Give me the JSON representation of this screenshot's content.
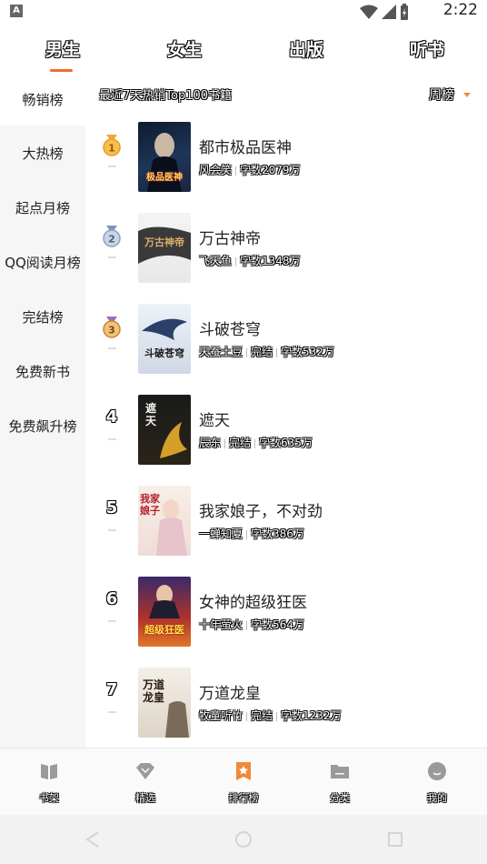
{
  "status": {
    "time": "2:22",
    "badge": "A"
  },
  "top_tabs": [
    "男生",
    "女生",
    "出版",
    "听书"
  ],
  "sidebar": {
    "items": [
      "畅销榜",
      "大热榜",
      "起点月榜",
      "QQ阅读月榜",
      "完结榜",
      "免费新书",
      "免费飙升榜"
    ]
  },
  "list_header": {
    "title": "最近7天热销Top100书籍",
    "period": "周榜"
  },
  "books": [
    {
      "rank": "1",
      "title": "都市极品医神",
      "author": "风会笑",
      "status": "",
      "words": "字数2079万",
      "cover_text": "极品医神"
    },
    {
      "rank": "2",
      "title": "万古神帝",
      "author": "飞天鱼",
      "status": "",
      "words": "字数1348万",
      "cover_text": "万古神帝"
    },
    {
      "rank": "3",
      "title": "斗破苍穹",
      "author": "天蚕土豆",
      "status": "完结",
      "words": "字数532万",
      "cover_text": "斗破苍穹"
    },
    {
      "rank": "4",
      "title": "遮天",
      "author": "辰东",
      "status": "完结",
      "words": "字数635万",
      "cover_text": "遮天"
    },
    {
      "rank": "5",
      "title": "我家娘子，不对劲",
      "author": "一蝉知夏",
      "status": "",
      "words": "字数386万",
      "cover_text": "我家娘子"
    },
    {
      "rank": "6",
      "title": "女神的超级狂医",
      "author": "十年萤火",
      "status": "",
      "words": "字数564万",
      "cover_text": "超级狂医"
    },
    {
      "rank": "7",
      "title": "万道龙皇",
      "author": "牧童听竹",
      "status": "完结",
      "words": "字数1232万",
      "cover_text": "万道龙皇"
    }
  ],
  "bottom_nav": [
    "书架",
    "精选",
    "排行榜",
    "分类",
    "我的"
  ],
  "colors": {
    "accent": "#f26b2b",
    "gold": "#f0a93a",
    "silver": "#8aa0bf",
    "bronze": "#c6862f"
  }
}
